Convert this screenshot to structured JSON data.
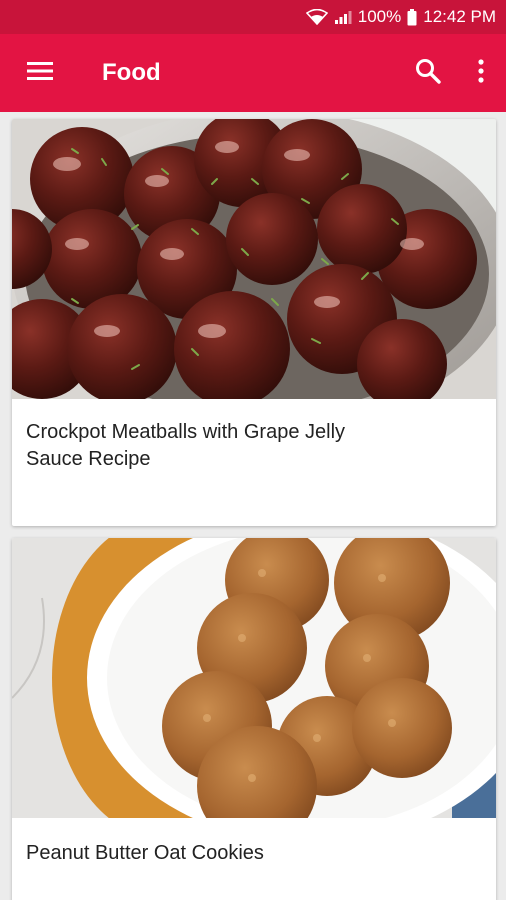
{
  "status_bar": {
    "battery": "100%",
    "time": "12:42 PM"
  },
  "app_bar": {
    "title": "Food",
    "menu_icon": "hamburger-menu-icon",
    "search_icon": "search-icon",
    "more_icon": "more-vert-icon"
  },
  "colors": {
    "status_bar": "#c8143a",
    "app_bar": "#e31443",
    "background": "#ececec"
  },
  "recipes": [
    {
      "title": "Crockpot Meatballs with Grape Jelly Sauce Recipe"
    },
    {
      "title": "Peanut Butter Oat Cookies"
    }
  ]
}
